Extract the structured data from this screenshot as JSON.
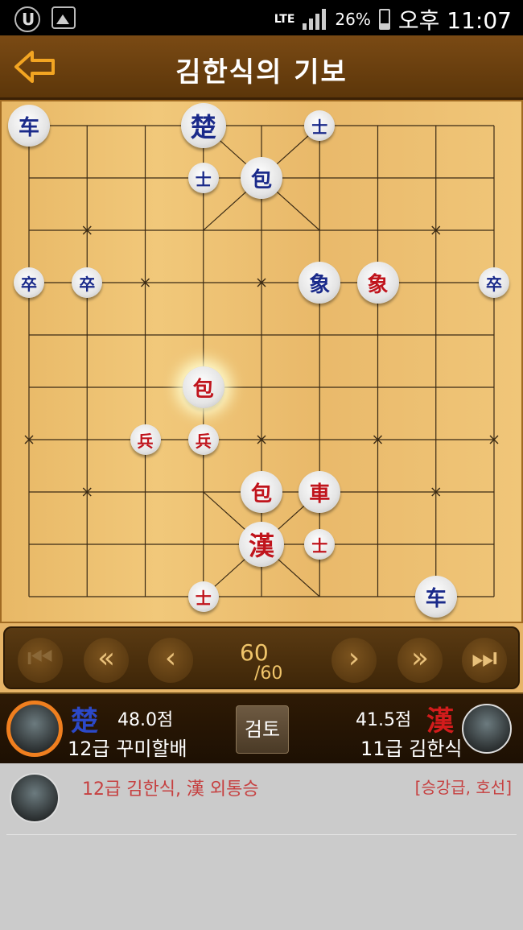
{
  "status_bar": {
    "network": "LTE",
    "battery": "26%",
    "time": "오후 11:07"
  },
  "header": {
    "title": "김한식의 기보"
  },
  "board": {
    "pieces": [
      {
        "char": "车",
        "side": "blue",
        "size": "normal",
        "file": 0,
        "rank": 0
      },
      {
        "char": "楚",
        "side": "blue",
        "size": "large",
        "file": 3,
        "rank": 0
      },
      {
        "char": "士",
        "side": "blue",
        "size": "small",
        "file": 5,
        "rank": 0
      },
      {
        "char": "士",
        "side": "blue",
        "size": "small",
        "file": 3,
        "rank": 1
      },
      {
        "char": "包",
        "side": "blue",
        "size": "normal",
        "file": 4,
        "rank": 1
      },
      {
        "char": "卒",
        "side": "blue",
        "size": "small",
        "file": 0,
        "rank": 3
      },
      {
        "char": "卒",
        "side": "blue",
        "size": "small",
        "file": 1,
        "rank": 3
      },
      {
        "char": "象",
        "side": "blue",
        "size": "normal",
        "file": 5,
        "rank": 3
      },
      {
        "char": "象",
        "side": "red",
        "size": "normal",
        "file": 6,
        "rank": 3
      },
      {
        "char": "卒",
        "side": "blue",
        "size": "small",
        "file": 8,
        "rank": 3
      },
      {
        "char": "包",
        "side": "red",
        "size": "normal",
        "file": 3,
        "rank": 5,
        "highlight": true
      },
      {
        "char": "兵",
        "side": "red",
        "size": "small",
        "file": 2,
        "rank": 6
      },
      {
        "char": "兵",
        "side": "red",
        "size": "small",
        "file": 3,
        "rank": 6
      },
      {
        "char": "包",
        "side": "red",
        "size": "normal",
        "file": 4,
        "rank": 7
      },
      {
        "char": "車",
        "side": "red",
        "size": "normal",
        "file": 5,
        "rank": 7
      },
      {
        "char": "漢",
        "side": "red",
        "size": "large",
        "file": 4,
        "rank": 8
      },
      {
        "char": "士",
        "side": "red",
        "size": "small",
        "file": 5,
        "rank": 8
      },
      {
        "char": "士",
        "side": "red",
        "size": "small",
        "file": 3,
        "rank": 9
      },
      {
        "char": "车",
        "side": "blue",
        "size": "normal",
        "file": 7,
        "rank": 9
      }
    ]
  },
  "controls": {
    "first_icon": "skip-to-first-icon",
    "back_fast_icon": "fast-rewind-icon",
    "prev_icon": "previous-icon",
    "next_icon": "next-icon",
    "forward_fast_icon": "fast-forward-icon",
    "last_icon": "skip-to-last-icon",
    "move_current": "60",
    "move_total": "/60"
  },
  "players": {
    "cho": {
      "symbol": "楚",
      "score": "48.0점",
      "name": "12급 꾸미할배"
    },
    "han": {
      "symbol": "漢",
      "score": "41.5점",
      "name": "11급 김한식"
    },
    "review_label": "검토"
  },
  "result": {
    "text": "12급 김한식, 漢 외통승",
    "tag": "[승강급, 호선]"
  }
}
